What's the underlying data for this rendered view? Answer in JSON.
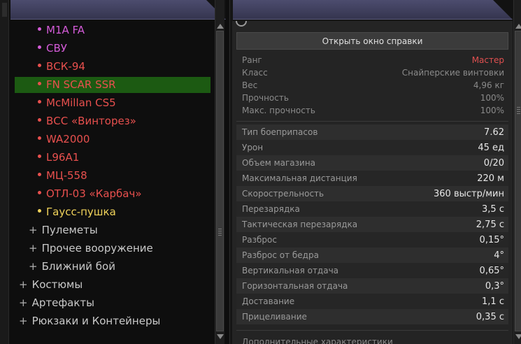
{
  "left_tree": {
    "weapons": [
      {
        "label": "M1A FA",
        "color": "#d45bd8"
      },
      {
        "label": "СВУ",
        "color": "#d45bd8"
      },
      {
        "label": "ВСК-94",
        "color": "#e8504e"
      },
      {
        "label": "FN SCAR SSR",
        "color": "#e8504e",
        "selected": true
      },
      {
        "label": "McMillan CS5",
        "color": "#e8504e"
      },
      {
        "label": "ВСС «Винторез»",
        "color": "#e8504e"
      },
      {
        "label": "WA2000",
        "color": "#e8504e"
      },
      {
        "label": "L96A1",
        "color": "#e8504e"
      },
      {
        "label": "МЦ-558",
        "color": "#e8504e"
      },
      {
        "label": "ОТЛ-03 «Карбач»",
        "color": "#e8504e"
      },
      {
        "label": "Гаусс-пушка",
        "color": "#f0d25a"
      }
    ],
    "subcategories": [
      {
        "label": "Пулеметы"
      },
      {
        "label": "Прочее вооружение"
      },
      {
        "label": "Ближний бой"
      }
    ],
    "categories": [
      {
        "label": "Костюмы"
      },
      {
        "label": "Артефакты"
      },
      {
        "label": "Рюкзаки и Контейнеры"
      }
    ],
    "expand_symbol": "+"
  },
  "help_button": "Открыть окно справки",
  "basic_stats": [
    {
      "key": "Ранг",
      "value": "Мастер",
      "value_color": "#e05050"
    },
    {
      "key": "Класс",
      "value": "Снайперские винтовки"
    },
    {
      "key": "Вес",
      "value": "4,96 кг"
    },
    {
      "key": "Прочность",
      "value": "100%"
    },
    {
      "key": "Макс. прочность",
      "value": "100%"
    }
  ],
  "combat_stats": [
    {
      "key": "Тип боеприпасов",
      "value": "7.62"
    },
    {
      "key": "Урон",
      "value": "45 ед"
    },
    {
      "key": "Объем магазина",
      "value": "0/20"
    },
    {
      "key": "Максимальная дистанция",
      "value": "220 м"
    },
    {
      "key": "Скорострельность",
      "value": "360 выстр/мин"
    },
    {
      "key": "Перезарядка",
      "value": "3,5 с"
    },
    {
      "key": "Тактическая перезарядка",
      "value": "2,75 с"
    },
    {
      "key": "Разброс",
      "value": "0,15°"
    },
    {
      "key": "Разброс от бедра",
      "value": "4°"
    },
    {
      "key": "Вертикальная отдача",
      "value": "0,65°"
    },
    {
      "key": "Горизонтальная отдача",
      "value": "0,3°"
    },
    {
      "key": "Доставание",
      "value": "1,1 с"
    },
    {
      "key": "Прицеливание",
      "value": "0,35 с"
    }
  ],
  "extra_heading": "Дополнительные характеристики",
  "colors": {
    "selected_row": "#1c5a12",
    "header": "#3f3f5c"
  }
}
